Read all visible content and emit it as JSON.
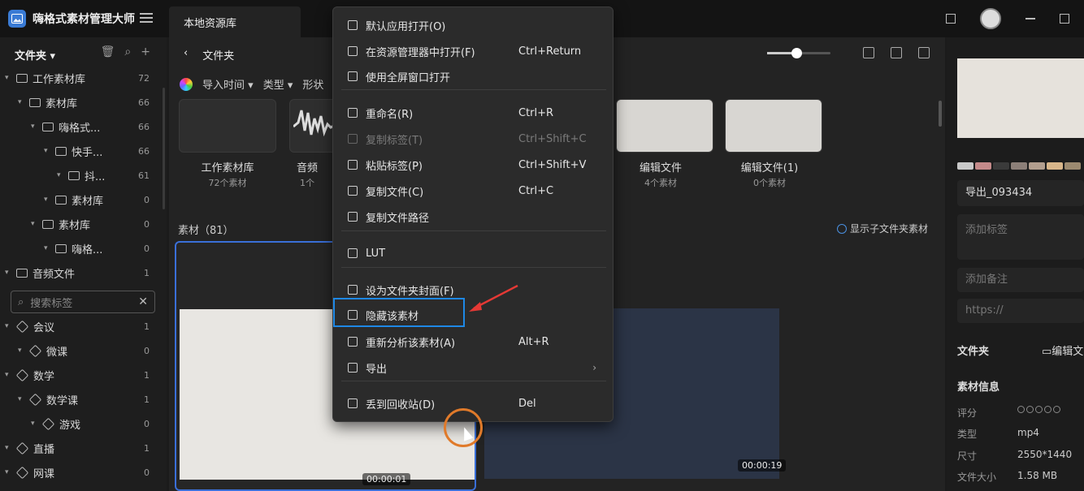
{
  "app": {
    "title": "嗨格式素材管理大师",
    "tab": "本地资源库"
  },
  "sidebar": {
    "header": "文件夹",
    "tree": [
      {
        "label": "工作素材库",
        "count": "72",
        "indent": 0
      },
      {
        "label": "素材库",
        "count": "66",
        "indent": 1
      },
      {
        "label": "嗨格式...",
        "count": "66",
        "indent": 2
      },
      {
        "label": "快手...",
        "count": "66",
        "indent": 3
      },
      {
        "label": "抖...",
        "count": "61",
        "indent": 4
      },
      {
        "label": "素材库",
        "count": "0",
        "indent": 3
      },
      {
        "label": "素材库",
        "count": "0",
        "indent": 2
      },
      {
        "label": "嗨格...",
        "count": "0",
        "indent": 3
      },
      {
        "label": "音频文件",
        "count": "1",
        "indent": 0
      }
    ],
    "search_placeholder": "搜索标签",
    "tags": [
      {
        "label": "会议",
        "count": "1",
        "indent": 0
      },
      {
        "label": "微课",
        "count": "0",
        "indent": 1
      },
      {
        "label": "数学",
        "count": "1",
        "indent": 0
      },
      {
        "label": "数学课",
        "count": "1",
        "indent": 1
      },
      {
        "label": "游戏",
        "count": "0",
        "indent": 2
      },
      {
        "label": "直播",
        "count": "1",
        "indent": 0
      },
      {
        "label": "网课",
        "count": "0",
        "indent": 0
      }
    ]
  },
  "main": {
    "back": "‹",
    "folder_label": "文件夹",
    "filters": [
      "导入时间",
      "类型",
      "形状"
    ],
    "folders": [
      {
        "name": "工作素材库",
        "count": "72个素材"
      },
      {
        "name": "音频",
        "count": "1个"
      },
      {
        "name": "编辑文件",
        "count": "4个素材"
      },
      {
        "name": "编辑文件(1)",
        "count": "0个素材"
      }
    ],
    "section_title": "素材（81）",
    "show_sub": "显示子文件夹素材",
    "durations": [
      "00:00:01",
      "00:00:19"
    ]
  },
  "context_menu": {
    "items": [
      {
        "label": "默认应用打开(O)",
        "shortcut": ""
      },
      {
        "label": "在资源管理器中打开(F)",
        "shortcut": "Ctrl+Return"
      },
      {
        "label": "使用全屏窗口打开",
        "shortcut": ""
      },
      {
        "label": "重命名(R)",
        "shortcut": "Ctrl+R"
      },
      {
        "label": "复制标签(T)",
        "shortcut": "Ctrl+Shift+C"
      },
      {
        "label": "粘贴标签(P)",
        "shortcut": "Ctrl+Shift+V"
      },
      {
        "label": "复制文件(C)",
        "shortcut": "Ctrl+C"
      },
      {
        "label": "复制文件路径",
        "shortcut": ""
      },
      {
        "label": "LUT",
        "shortcut": ""
      },
      {
        "label": "设为文件夹封面(F)",
        "shortcut": ""
      },
      {
        "label": "隐藏该素材",
        "shortcut": ""
      },
      {
        "label": "重新分析该素材(A)",
        "shortcut": "Alt+R"
      },
      {
        "label": "导出",
        "shortcut": ""
      },
      {
        "label": "丢到回收站(D)",
        "shortcut": "Del"
      }
    ]
  },
  "right_panel": {
    "filename": "导出_093434",
    "tag_placeholder": "添加标签",
    "note_placeholder": "添加备注",
    "url_placeholder": "https://",
    "folder_label": "文件夹",
    "folder_value": "编辑文",
    "info_title": "素材信息",
    "info": [
      {
        "key": "评分",
        "value": ""
      },
      {
        "key": "类型",
        "value": "mp4"
      },
      {
        "key": "尺寸",
        "value": "2550*1440"
      },
      {
        "key": "文件大小",
        "value": "1.58 MB"
      }
    ],
    "swatch_colors": [
      "#c9c9c9",
      "#c48a8a",
      "#3a3a3a",
      "#8c7f78",
      "#b29e8e",
      "#d8b68a",
      "#9c8a70"
    ]
  },
  "colors": {
    "accent": "#3a6fd8",
    "highlight": "#1e88e5",
    "annotation": "#e53935"
  }
}
